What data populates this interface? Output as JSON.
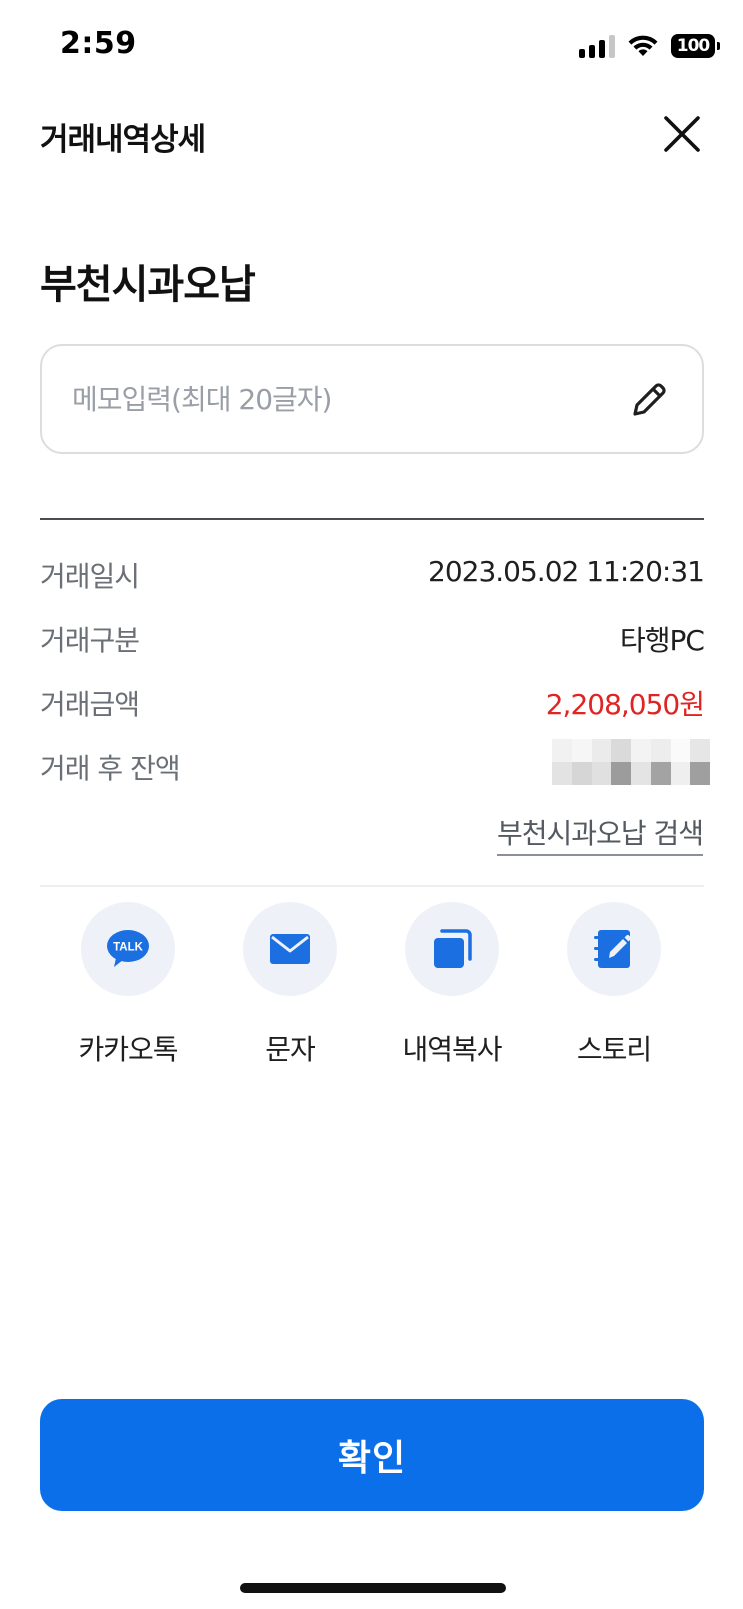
{
  "status_bar": {
    "time": "2:59",
    "battery": "100",
    "icons": [
      "signal-icon",
      "wifi-icon",
      "battery-icon"
    ]
  },
  "header": {
    "title": "거래내역상세",
    "close_icon": "close-icon"
  },
  "merchant": {
    "name": "부천시과오납"
  },
  "memo": {
    "value": "",
    "placeholder": "메모입력(최대 20글자)",
    "edit_icon": "pencil-icon"
  },
  "details": [
    {
      "label": "거래일시",
      "value": "2023.05.02 11:20:31"
    },
    {
      "label": "거래구분",
      "value": "타행PC"
    },
    {
      "label": "거래금액",
      "value": "2,208,050원"
    },
    {
      "label": "거래 후 잔액",
      "value": ""
    }
  ],
  "search_link": "부천시과오납 검색",
  "share": [
    {
      "label": "카카오톡",
      "icon": "kakaotalk-icon",
      "badge": "TALK"
    },
    {
      "label": "문자",
      "icon": "message-icon"
    },
    {
      "label": "내역복사",
      "icon": "copy-icon"
    },
    {
      "label": "스토리",
      "icon": "story-icon"
    }
  ],
  "confirm": {
    "label": "확인"
  },
  "colors": {
    "primary": "#0a6fe8",
    "amount": "#e02424",
    "icon_bg": "#eef2f8",
    "icon_blue": "#1b6fe0"
  }
}
